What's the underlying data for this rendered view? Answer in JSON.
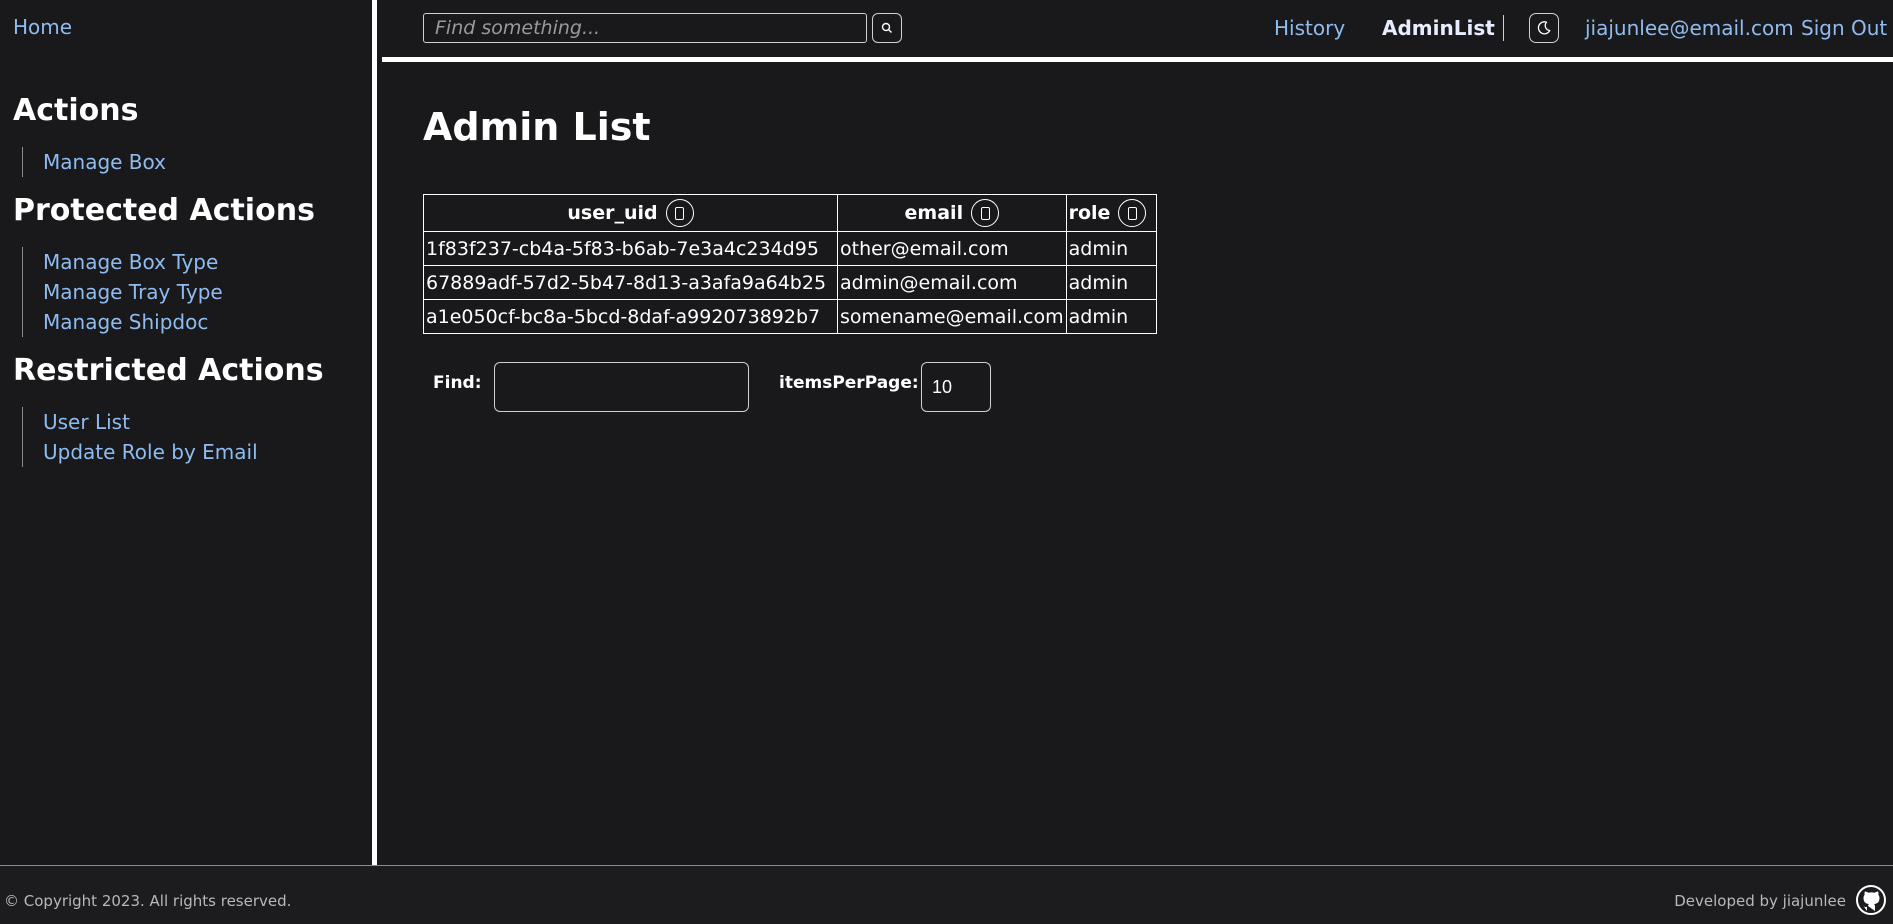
{
  "sidebar": {
    "home": "Home",
    "sections": [
      {
        "heading": "Actions",
        "items": [
          "Manage Box"
        ]
      },
      {
        "heading": "Protected Actions",
        "items": [
          "Manage Box Type",
          "Manage Tray Type",
          "Manage Shipdoc"
        ]
      },
      {
        "heading": "Restricted Actions",
        "items": [
          "User List",
          "Update Role by Email"
        ]
      }
    ]
  },
  "header": {
    "search_placeholder": "Find something...",
    "search_icon": "search-icon",
    "nav": {
      "history": "History",
      "admin_list": "AdminList",
      "email": "jiajunlee@email.com",
      "sign_out": "Sign Out"
    },
    "theme_icon": "moon-icon"
  },
  "main": {
    "title": "Admin List",
    "table": {
      "columns": [
        "user_uid",
        "email",
        "role"
      ],
      "rows": [
        [
          "1f83f237-cb4a-5f83-b6ab-7e3a4c234d95",
          "other@email.com",
          "admin"
        ],
        [
          "67889adf-57d2-5b47-8d13-a3afa9a64b25",
          "admin@email.com",
          "admin"
        ],
        [
          "a1e050cf-bc8a-5bcd-8daf-a992073892b7",
          "somename@email.com",
          "admin"
        ]
      ]
    },
    "filters": {
      "find_label": "Find:",
      "find_value": "",
      "items_per_page_label": "itemsPerPage:",
      "items_per_page_value": "10"
    }
  },
  "footer": {
    "copyright": "© Copyright 2023. All rights reserved.",
    "developed_by": "Developed by jiajunlee",
    "github_icon": "github-icon"
  },
  "colors": {
    "background": "#19191c",
    "link": "#8fbcf0",
    "border": "#ffffff"
  }
}
